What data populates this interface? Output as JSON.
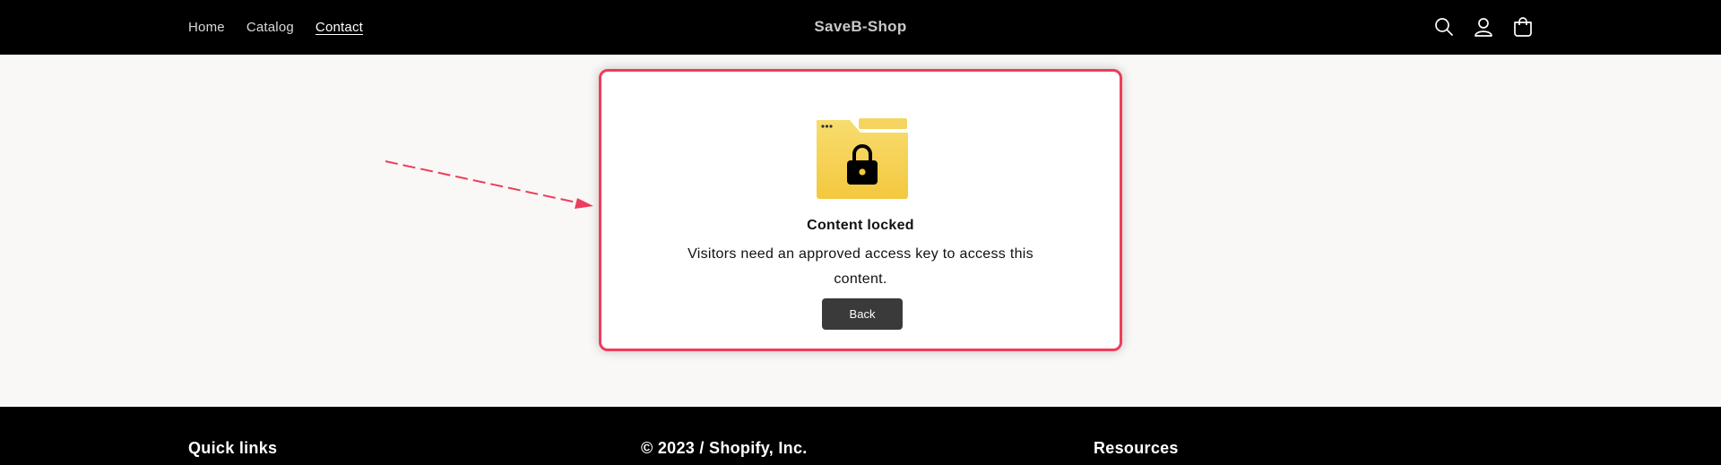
{
  "header": {
    "nav": [
      {
        "label": "Home"
      },
      {
        "label": "Catalog"
      },
      {
        "label": "Contact"
      }
    ],
    "brand": "SaveB-Shop",
    "icons": [
      "search-icon",
      "account-icon",
      "cart-icon"
    ]
  },
  "modal": {
    "icon": "locked-folder-icon",
    "title": "Content locked",
    "message": "Visitors need an approved access key to access this content.",
    "back_label": "Back",
    "border_color": "#ee3c5b"
  },
  "annotation": {
    "arrow_color": "#ee3c5b"
  },
  "footer": {
    "col1": "Quick links",
    "col2": "© 2023 / Shopify, Inc.",
    "col3": "Resources"
  }
}
